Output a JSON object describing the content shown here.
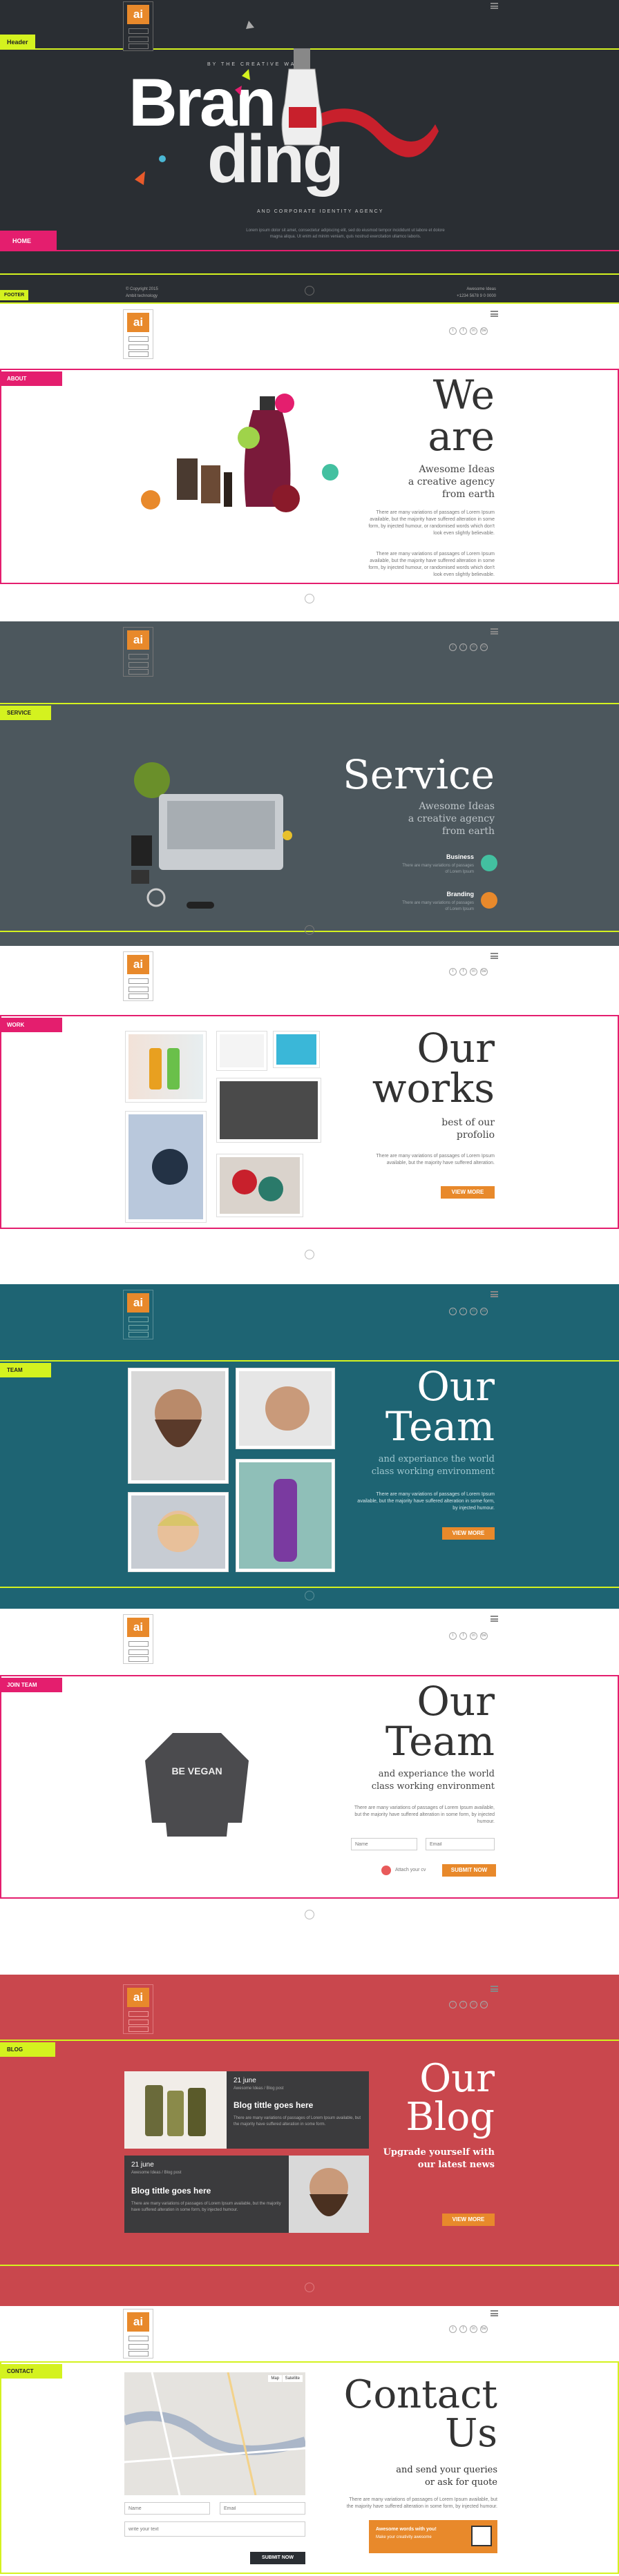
{
  "header": {
    "tag": "Header",
    "tagline": "BY THE CREATIVE WALLS",
    "title_top": "Bran",
    "title_bottom": "ding",
    "subtitle": "AND CORPORATE IDENTITY AGENCY",
    "home_tag": "HOME",
    "body_text": "Lorem ipsum dolor sit amet, consectetur adipiscing elit, sed do eiusmod tempor incididunt ut labore et dolore magna aliqua. Ut enim ad minim veniam, quis nostrud exercitation ullamco laboris."
  },
  "footer_strip": {
    "tag": "FOOTER",
    "copyright": "© Copyright 2015",
    "copyright_sub": "Ambit technology",
    "right_line1": "Awesome Ideas",
    "right_line2": "+1234 5678 9 0 0000"
  },
  "logo_letter": "ai",
  "social_icons": [
    "t",
    "f",
    "in",
    "be"
  ],
  "about": {
    "tag": "ABOUT",
    "heading1": "We",
    "heading2": "are",
    "sub1": "Awesome Ideas",
    "sub2": "a creative agency",
    "sub3": "from earth",
    "para1": "There are many variations of passages of Lorem Ipsum available, but the majority have suffered alteration in some form, by injected humour, or randomised words which don't look even slightly believable.",
    "para2": "There are many variations of passages of Lorem Ipsum available, but the majority have suffered alteration in some form, by injected humour, or randomised words which don't look even slightly believable."
  },
  "service": {
    "tag": "SERVICE",
    "heading": "Service",
    "sub1": "Awesome Ideas",
    "sub2": "a creative agency",
    "sub3": "from earth",
    "items": [
      {
        "title": "Business",
        "text": "There are many variations of passages of Lorem Ipsum"
      },
      {
        "title": "Branding",
        "text": "There are many variations of passages of Lorem Ipsum"
      }
    ]
  },
  "work": {
    "tag": "WORK",
    "heading1": "Our",
    "heading2": "works",
    "sub1": "best of our",
    "sub2": "profolio",
    "para": "There are many variations of passages of Lorem Ipsum available, but the majority have suffered alteration.",
    "button": "VIEW MORE"
  },
  "team": {
    "tag": "TEAM",
    "heading1": "Our",
    "heading2": "Team",
    "sub1": "and experiance the world",
    "sub2": "class working environment",
    "para": "There are many variations of passages of Lorem Ipsum available, but the majority have suffered alteration in some form, by injected humour.",
    "button": "VIEW MORE"
  },
  "join": {
    "tag": "JOIN TEAM",
    "heading1": "Our",
    "heading2": "Team",
    "sub1": "and experiance the world",
    "sub2": "class working environment",
    "para": "There are many variations of passages of Lorem Ipsum available, but the majority have suffered alteration in some form, by injected humour.",
    "name_placeholder": "Name",
    "email_placeholder": "Email",
    "attach_label": "Attach your cv",
    "button": "SUBMIT NOW",
    "sweater_text": "BE VEGAN"
  },
  "blog": {
    "tag": "BLOG",
    "heading1": "Our",
    "heading2": "Blog",
    "sub1": "Upgrade yourself with",
    "sub2": "our latest news",
    "button": "VIEW MORE",
    "posts": [
      {
        "date": "21 june",
        "meta": "Awesome Ideas / Blog post",
        "title": "Blog tittle goes here",
        "text": "There are many variations of passages of Lorem Ipsum available, but the majority have suffered alteration in some form."
      },
      {
        "date": "21 june",
        "meta": "Awesome Ideas / Blog post",
        "title": "Blog tittle goes here",
        "text": "There are many variations of passages of Lorem Ipsum available, but the majority have suffered alteration in some form, by injected humour."
      }
    ]
  },
  "contact": {
    "tag": "CONTACT",
    "heading1": "Contact",
    "heading2": "Us",
    "sub1": "and send your queries",
    "sub2": "or ask for quote",
    "para": "There are many variations of passages of Lorem Ipsum available, but the majority have suffered alteration in some form, by injected humour.",
    "name_placeholder": "Name",
    "email_placeholder": "Email",
    "message_placeholder": "write your text",
    "button": "SUBMIT NOW",
    "promo_line1": "Awesome words with you!",
    "promo_line2": "Make your creativity awesome",
    "map_btn1": "Map",
    "map_btn2": "Satellite"
  },
  "colors": {
    "dark": "#2a2e33",
    "slate": "#4c575d",
    "teal": "#1e6473",
    "red": "#c9474d",
    "accent_pink": "#e41e6e",
    "accent_lime": "#d4f21f",
    "orange": "#e8892b"
  }
}
